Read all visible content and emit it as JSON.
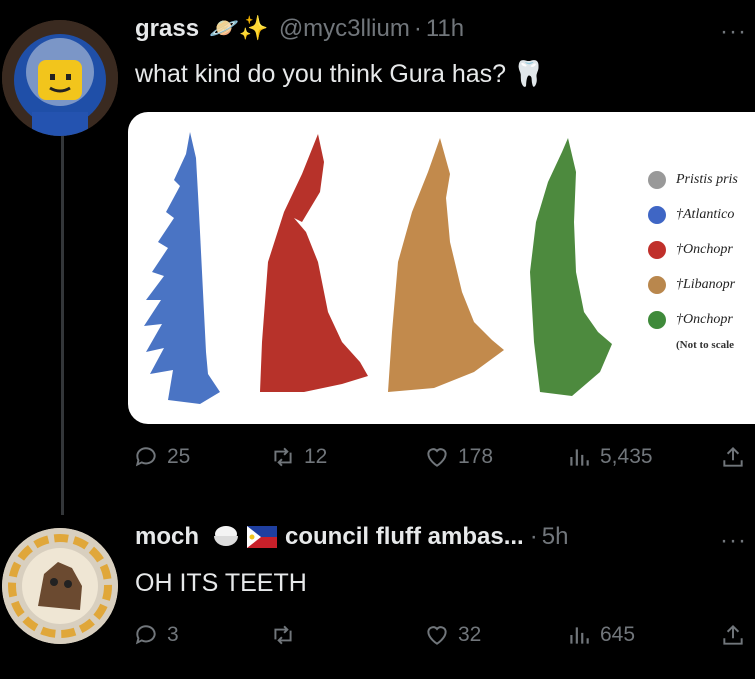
{
  "post": {
    "display_name": "grass",
    "name_emoji": "🪐✨",
    "handle": "@myc3llium",
    "separator": "·",
    "time": "11h",
    "text": "what kind do you think Gura has?",
    "text_emoji": "🦷",
    "more": "···",
    "image": {
      "tooth_colors": [
        "#4a74c4",
        "#b7322a",
        "#c28a4c",
        "#4d8a3e"
      ],
      "legend": [
        {
          "label": "Pristis pris",
          "color": "#999999"
        },
        {
          "label": "†Atlantico",
          "color": "#3f66c5"
        },
        {
          "label": "†Onchopr",
          "color": "#c0302b"
        },
        {
          "label": "†Libanopr",
          "color": "#b9874d"
        },
        {
          "label": "†Onchopr",
          "color": "#3f8a3a"
        }
      ],
      "note": "(Not to scale"
    },
    "actions": {
      "replies": "25",
      "reposts": "12",
      "likes": "178",
      "views": "5,435"
    }
  },
  "reply": {
    "display_name": "moch",
    "bio": "council fluff ambas...",
    "separator": "·",
    "time": "5h",
    "text": "OH ITS TEETH",
    "more": "···",
    "actions": {
      "replies": "3",
      "reposts": "",
      "likes": "32",
      "views": "645"
    }
  }
}
